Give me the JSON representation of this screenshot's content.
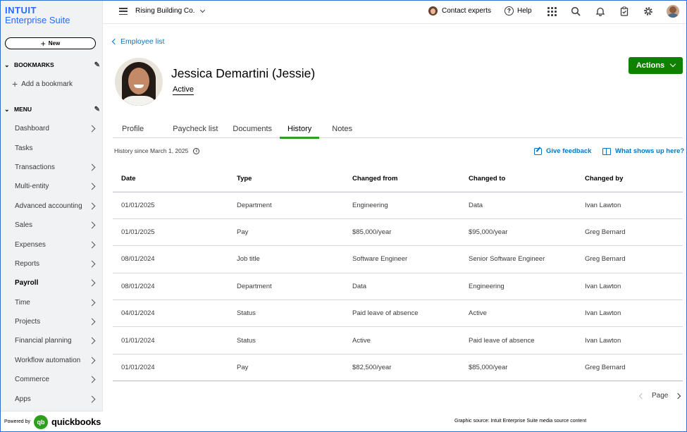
{
  "brand": {
    "line1": "INTUIT",
    "line2": "Enterprise Suite"
  },
  "sidebar": {
    "new_label": "New",
    "bookmarks_label": "BOOKMARKS",
    "add_bookmark_label": "Add a bookmark",
    "menu_label": "MENU",
    "items": [
      {
        "label": "Dashboard",
        "chevron": true
      },
      {
        "label": "Tasks",
        "chevron": false
      },
      {
        "label": "Transactions",
        "chevron": true
      },
      {
        "label": "Multi-entity",
        "chevron": true
      },
      {
        "label": "Advanced accounting",
        "chevron": true
      },
      {
        "label": "Sales",
        "chevron": true
      },
      {
        "label": "Expenses",
        "chevron": true
      },
      {
        "label": "Reports",
        "chevron": true
      },
      {
        "label": "Payroll",
        "chevron": true,
        "active": true
      },
      {
        "label": "Time",
        "chevron": true
      },
      {
        "label": "Projects",
        "chevron": true
      },
      {
        "label": "Financial planning",
        "chevron": true
      },
      {
        "label": "Workflow automation",
        "chevron": true
      },
      {
        "label": "Commerce",
        "chevron": true
      },
      {
        "label": "Apps",
        "chevron": true
      }
    ],
    "powered_by": "Powered by",
    "qb_logo": "qb",
    "qb_word": "quickbooks"
  },
  "topbar": {
    "company": "Rising Building Co.",
    "contact_experts": "Contact experts",
    "help": "Help",
    "help_icon": "?"
  },
  "employee": {
    "back_label": "Employee list",
    "name": "Jessica Demartini (Jessie)",
    "status": "Active",
    "actions_label": "Actions"
  },
  "tabs": [
    {
      "label": "Profile",
      "selected": false
    },
    {
      "label": "Paycheck list",
      "selected": false
    },
    {
      "label": "Documents",
      "selected": false
    },
    {
      "label": "History",
      "selected": true
    },
    {
      "label": "Notes",
      "selected": false
    }
  ],
  "history": {
    "since": "History since March 1, 2025",
    "info_icon": "i",
    "give_feedback": "Give feedback",
    "what_shows_up": "What shows up here?",
    "columns": [
      "Date",
      "Type",
      "Changed from",
      "Changed to",
      "Changed by"
    ],
    "rows": [
      [
        "01/01/2025",
        "Department",
        "Engineering",
        "Data",
        "Ivan Lawton"
      ],
      [
        "01/01/2025",
        "Pay",
        "$85,000/year",
        "$95,000/year",
        "Greg Bernard"
      ],
      [
        "08/01/2024",
        "Job title",
        "Software Engineer",
        "Senior Software Engineer",
        "Greg Bernard"
      ],
      [
        "08/01/2024",
        "Department",
        "Data",
        "Engineering",
        "Ivan Lawton"
      ],
      [
        "04/01/2024",
        "Status",
        "Paid leave of absence",
        "Active",
        "Ivan Lawton"
      ],
      [
        "01/01/2024",
        "Status",
        "Active",
        "Paid leave of absence",
        "Ivan Lawton"
      ],
      [
        "01/01/2024",
        "Pay",
        "$82,500/year",
        "$85,000/year",
        "Greg Bernard"
      ]
    ]
  },
  "pager": {
    "label": "Page"
  },
  "credit": "Graphic source: Intuit Enterprise Suite media source content",
  "colors": {
    "brand_blue": "#236cff",
    "link_blue": "#0077c5",
    "action_green": "#108000",
    "tab_green": "#2ca01c"
  }
}
